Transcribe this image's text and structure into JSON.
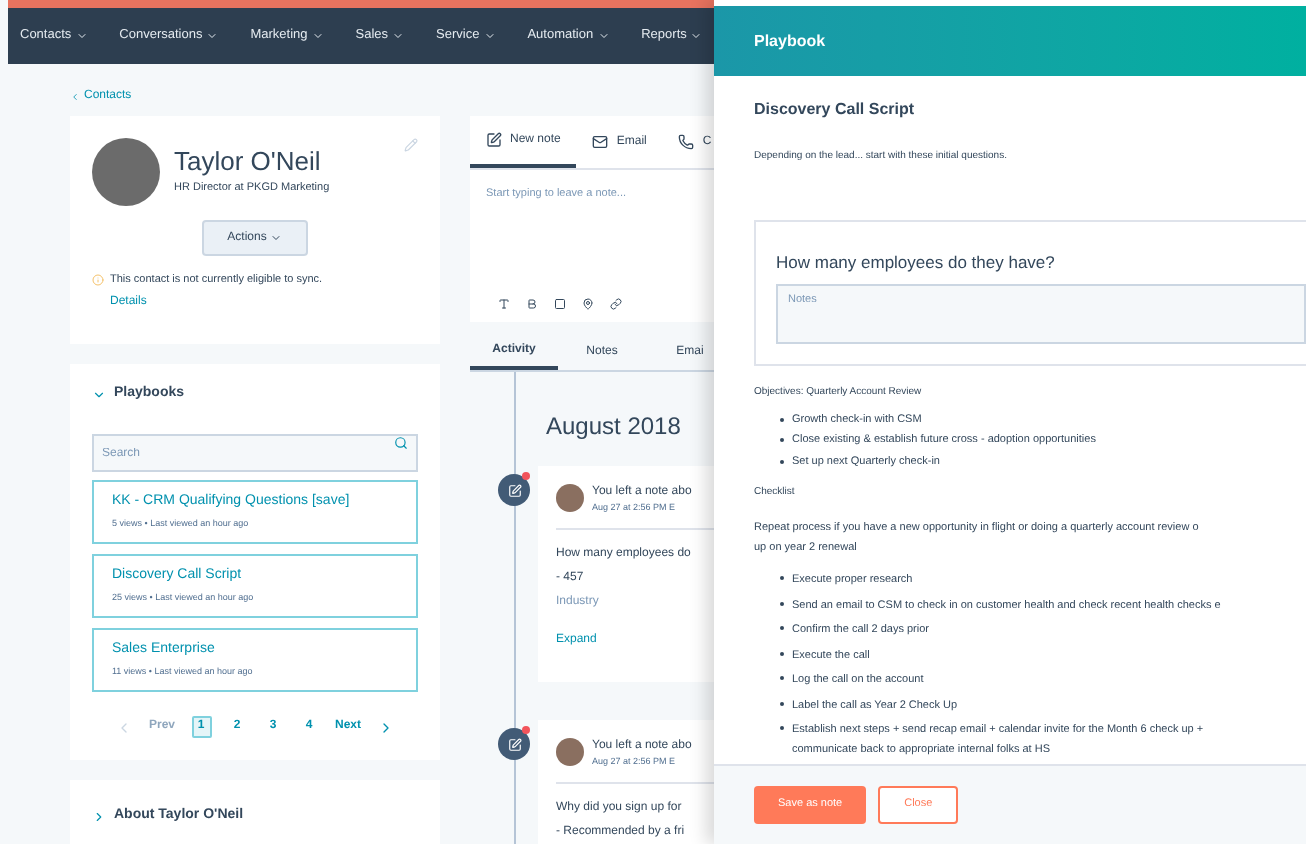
{
  "nav": [
    {
      "label": "Contacts"
    },
    {
      "label": "Conversations"
    },
    {
      "label": "Marketing"
    },
    {
      "label": "Sales"
    },
    {
      "label": "Service"
    },
    {
      "label": "Automation"
    },
    {
      "label": "Reports"
    }
  ],
  "breadcrumb": "Contacts",
  "contact": {
    "name": "Taylor O'Neil",
    "title": "HR Director at PKGD Marketing",
    "actions": "Actions",
    "sync_warning": "This contact is not currently eligible to sync.",
    "details_link": "Details"
  },
  "playbooks": {
    "heading": "Playbooks",
    "expanded": true,
    "search_placeholder": "Search",
    "items": [
      {
        "title": "KK - CRM Qualifying Questions [save]",
        "meta": "5 views • Last viewed an hour ago"
      },
      {
        "title": "Discovery Call Script",
        "meta": "25 views • Last viewed an hour ago"
      },
      {
        "title": "Sales Enterprise",
        "meta": "11 views • Last viewed an hour ago"
      }
    ],
    "pagination": {
      "prev": "Prev",
      "next": "Next",
      "pages": [
        {
          "label": "1",
          "selected": true
        },
        {
          "label": "2",
          "selected": false
        },
        {
          "label": "3",
          "selected": false
        },
        {
          "label": "4",
          "selected": false
        }
      ]
    }
  },
  "about": {
    "heading": "About Taylor O'Neil",
    "expanded": false
  },
  "composer": {
    "tabs": [
      {
        "label": "New note",
        "kind": "note",
        "selected": true
      },
      {
        "label": "Email",
        "kind": "email",
        "selected": false
      },
      {
        "label": "C",
        "kind": "call",
        "selected": false
      }
    ],
    "placeholder": "Start typing to leave a note..."
  },
  "activity_tabs": [
    {
      "label": "Activity",
      "selected": true
    },
    {
      "label": "Notes",
      "selected": false
    },
    {
      "label": "Emai",
      "selected": false
    }
  ],
  "timeline": {
    "month": "August 2018",
    "entries": [
      {
        "title": "You left a note abo",
        "time": "Aug 27 at 2:56 PM E",
        "lines": [
          "How many employees do",
          "- 457"
        ],
        "muted": "Industry",
        "link": "Expand"
      },
      {
        "title": "You left a note abo",
        "time": "Aug 27 at 2:56 PM E",
        "lines": [
          "Why did you sign up for",
          "- Recommended by a fri"
        ]
      }
    ]
  },
  "panel": {
    "title": "Playbook",
    "heading": "Discovery Call Script",
    "intro": "Depending on the lead... start with these initial questions.",
    "question": "How many employees do they have?",
    "notes_placeholder": "Notes",
    "objectives": "Objectives: Quarterly Account Review",
    "objective_items": [
      "Growth check-in with CSM",
      "Close existing & establish future cross - adoption opportunities",
      "Set up next Quarterly check-in"
    ],
    "checklist_heading": "Checklist",
    "checklist_intro": [
      "Repeat process if you have a new opportunity in flight or doing a quarterly account review o",
      "up on year 2 renewal"
    ],
    "checklist_items": [
      "Execute proper research",
      "Send an email to CSM to check in on customer health and check recent health checks e",
      "Confirm the call 2 days prior",
      "Execute the call",
      "Log the call on the account",
      "Label the call as Year 2 Check Up",
      "Establish next steps + send recap email + calendar invite for the Month 6 check up + communicate back to appropriate internal folks at HS"
    ],
    "save_button": "Save as note",
    "close_button": "Close"
  }
}
